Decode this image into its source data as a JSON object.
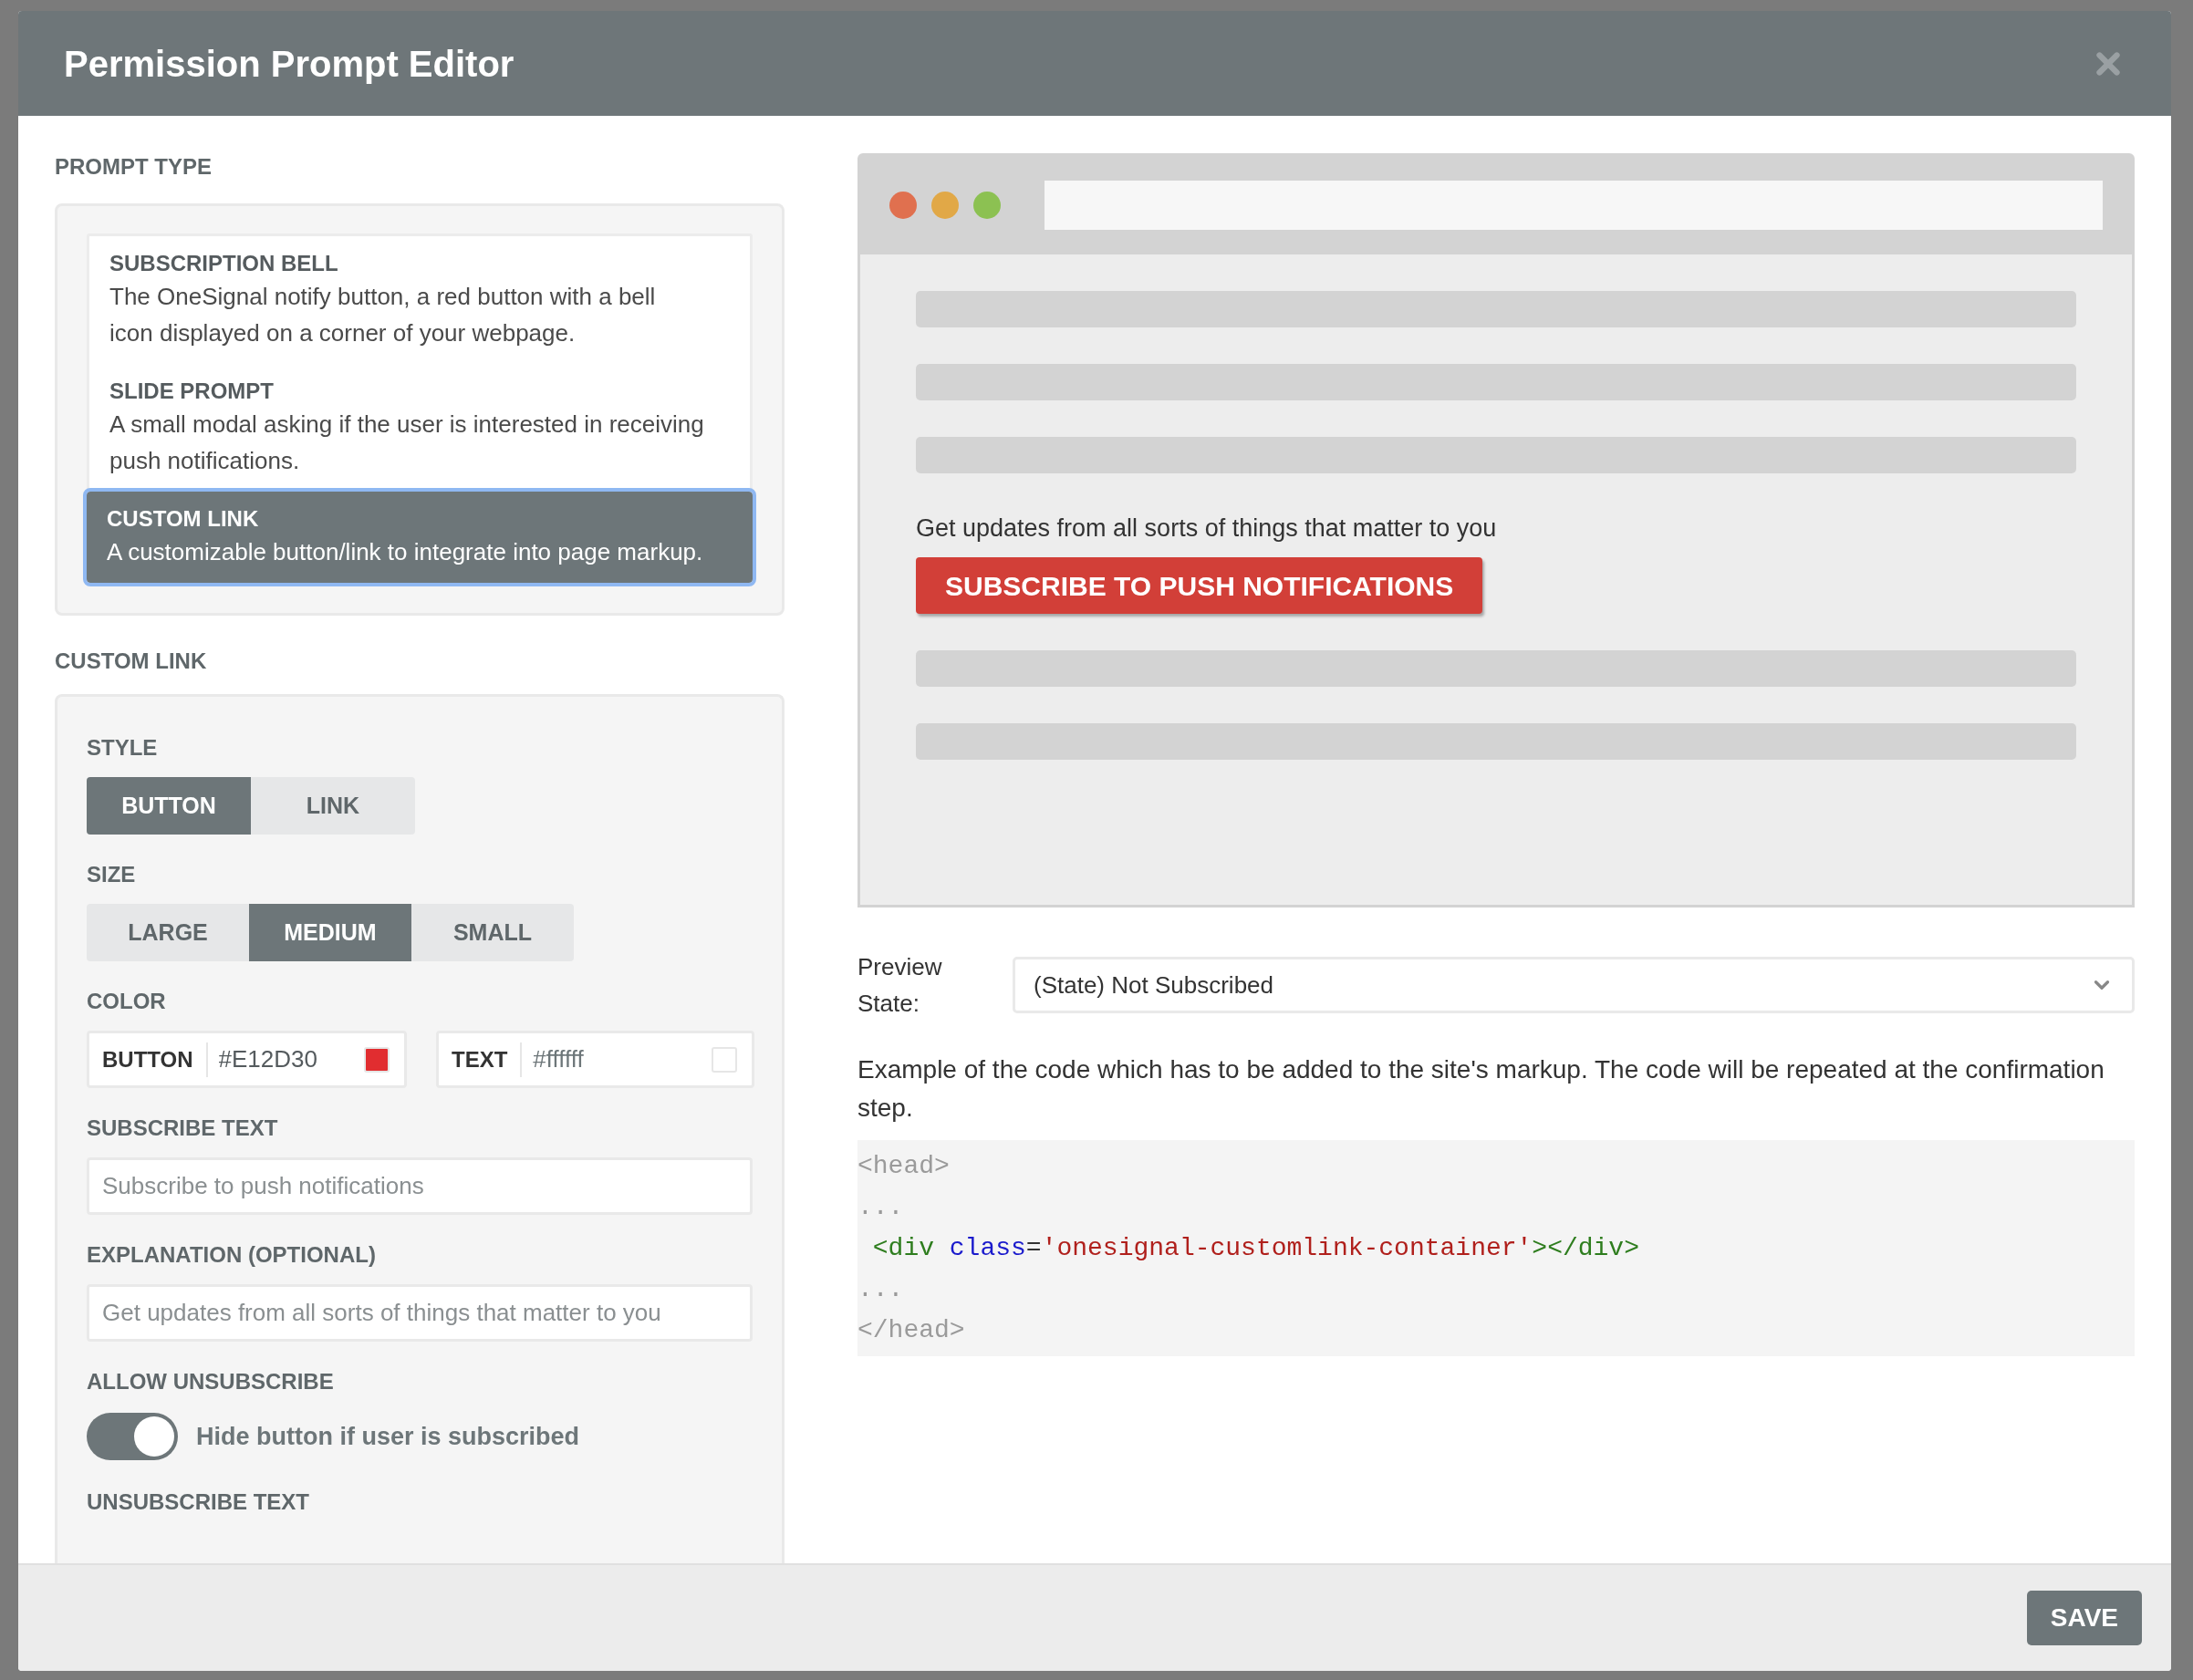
{
  "window": {
    "title": "Permission Prompt Editor"
  },
  "prompt_type": {
    "label": "PROMPT TYPE",
    "options": [
      {
        "title": "SUBSCRIPTION BELL",
        "description": "The OneSignal notify button, a red button with a bell icon displayed on a corner of your webpage.",
        "selected": false
      },
      {
        "title": "SLIDE PROMPT",
        "description": "A small modal asking if the user is interested in receiving push notifications.",
        "selected": false
      },
      {
        "title": "CUSTOM LINK",
        "description": "A customizable button/link to integrate into page markup.",
        "selected": true
      }
    ]
  },
  "custom_link": {
    "label": "CUSTOM LINK",
    "style": {
      "label": "STYLE",
      "options": [
        {
          "label": "BUTTON",
          "selected": true
        },
        {
          "label": "LINK",
          "selected": false
        }
      ]
    },
    "size": {
      "label": "SIZE",
      "options": [
        {
          "label": "LARGE",
          "selected": false
        },
        {
          "label": "MEDIUM",
          "selected": true
        },
        {
          "label": "SMALL",
          "selected": false
        }
      ]
    },
    "color": {
      "label": "COLOR",
      "fields": [
        {
          "label": "BUTTON",
          "value": "#E12D30",
          "color": "#e12d30"
        },
        {
          "label": "TEXT",
          "value": "#ffffff",
          "color": "#ffffff"
        }
      ]
    },
    "subscribe_text": {
      "label": "SUBSCRIBE TEXT",
      "placeholder": "Subscribe to push notifications"
    },
    "explanation": {
      "label": "EXPLANATION (OPTIONAL)",
      "placeholder": "Get updates from all sorts of things that matter to you"
    },
    "allow_unsubscribe": {
      "label": "ALLOW UNSUBSCRIBE",
      "on": true,
      "text": "Hide button if user is subscribed"
    },
    "unsubscribe_text": {
      "label": "UNSUBSCRIBE TEXT"
    }
  },
  "preview": {
    "text": "Get updates from all sorts of things that matter to you",
    "button": "SUBSCRIBE TO PUSH NOTIFICATIONS"
  },
  "preview_state": {
    "label": "Preview State:",
    "value": "(State) Not Subscribed"
  },
  "code_note": "Example of the code which has to be added to the site's markup. The code will be repeated at the confirmation step.",
  "code_lines": [
    {
      "tokens": [
        {
          "kind": "muted",
          "text": "<head>"
        }
      ]
    },
    {
      "tokens": [
        {
          "kind": "muted",
          "text": "..."
        }
      ]
    },
    {
      "tokens": [
        {
          "kind": "tag",
          "text": " <div"
        },
        {
          "kind": "attr",
          "text": " class"
        },
        {
          "kind": "plain",
          "text": "="
        },
        {
          "kind": "string",
          "text": "'onesignal-customlink-container'"
        },
        {
          "kind": "tag",
          "text": "></div>"
        }
      ]
    },
    {
      "tokens": [
        {
          "kind": "muted",
          "text": "..."
        }
      ]
    },
    {
      "tokens": [
        {
          "kind": "muted",
          "text": "</head>"
        }
      ]
    }
  ],
  "footer": {
    "save": "SAVE"
  }
}
